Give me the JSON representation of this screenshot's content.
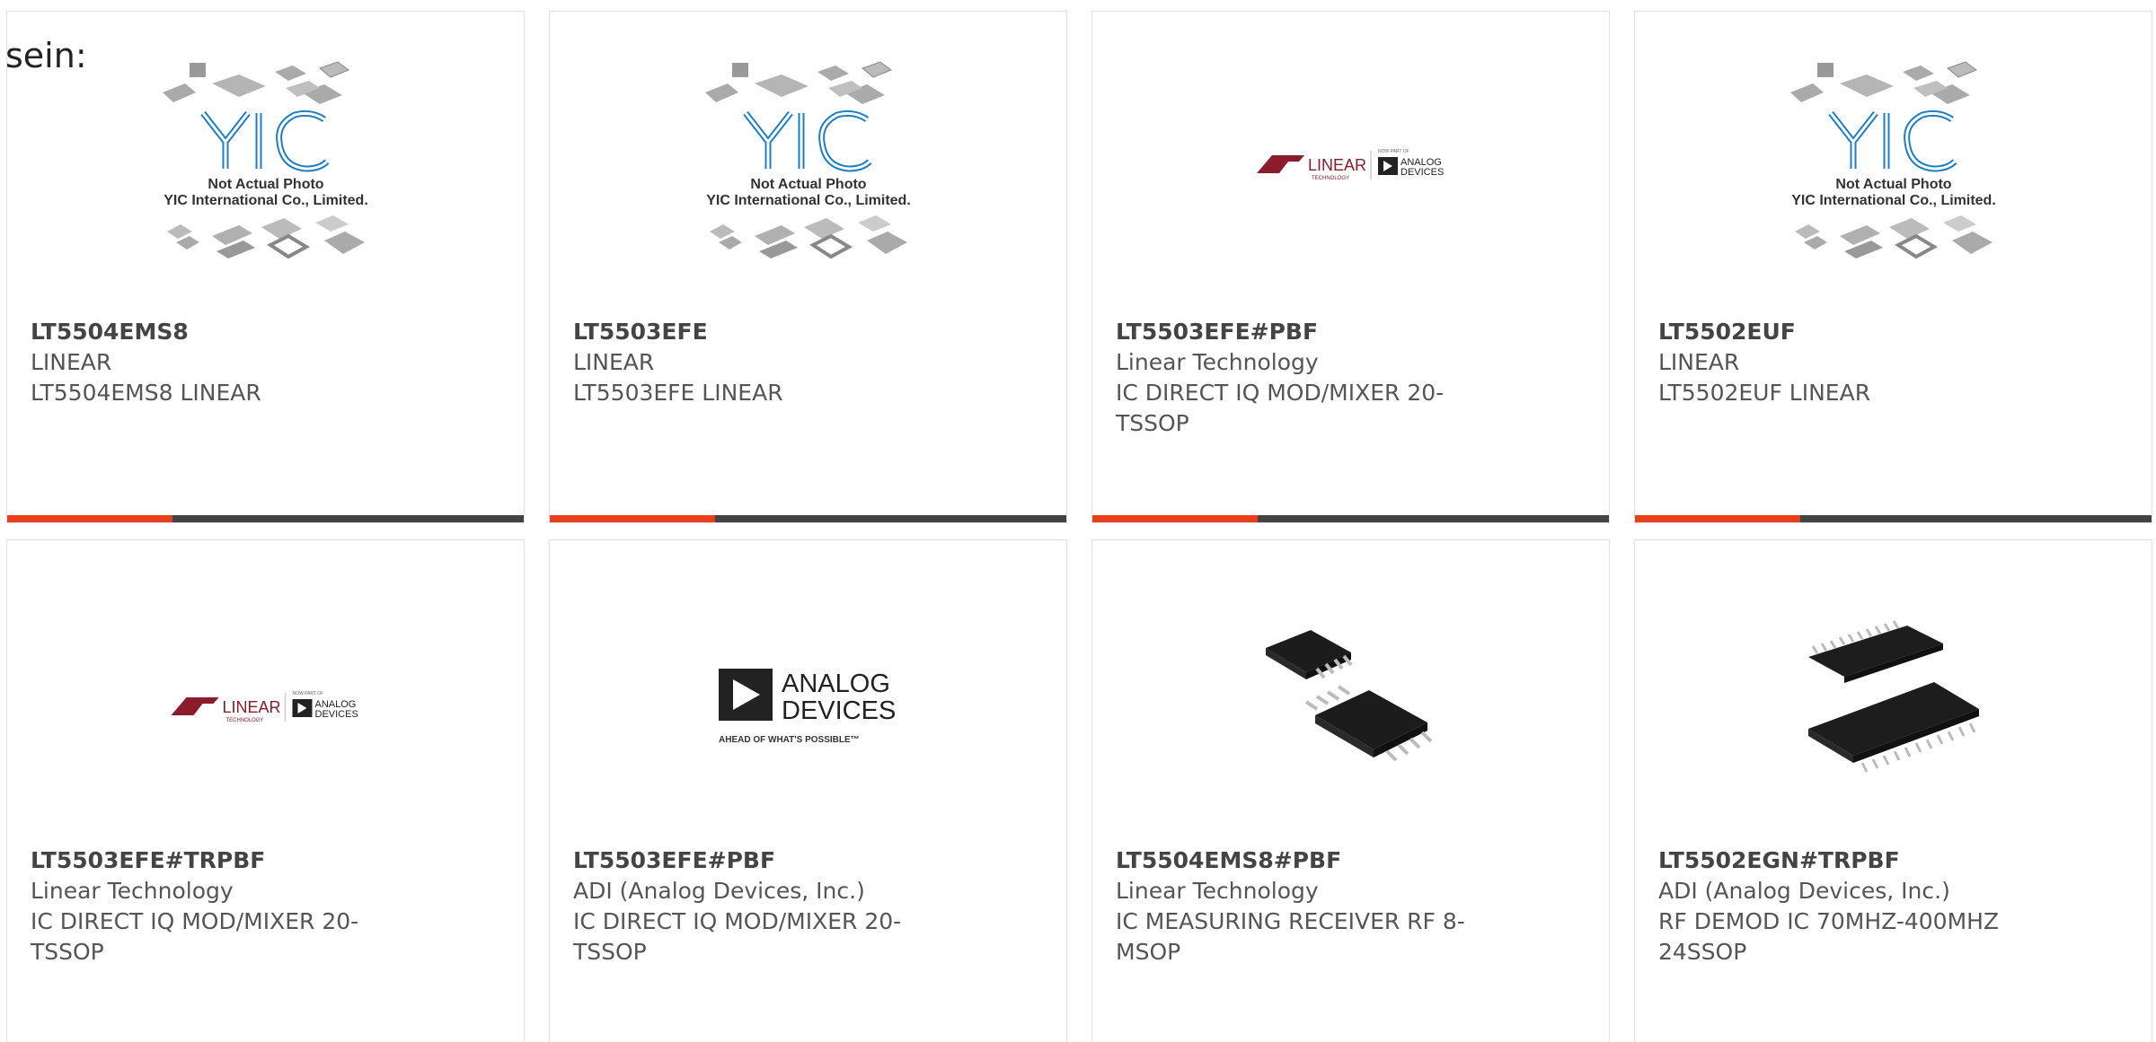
{
  "top_text": "sein:",
  "placeholder": {
    "brand": "YIC",
    "line1": "Not Actual Photo",
    "line2": "YIC International Co., Limited."
  },
  "linear_logo": {
    "brand": "LINEAR",
    "sub": "TECHNOLOGY",
    "now_part_of": "NOW PART OF",
    "adi": [
      "ANALOG",
      "DEVICES"
    ]
  },
  "adi_logo": {
    "line1": "ANALOG",
    "line2": "DEVICES",
    "tagline": "AHEAD OF WHAT'S POSSIBLE™"
  },
  "colors": {
    "accent": "#e8401c",
    "bar": "#434343",
    "yic_blue": "#1f7fc1",
    "linear_red": "#8b1c2c"
  },
  "products": [
    {
      "part": "LT5504EMS8",
      "maker": "LINEAR",
      "desc": "LT5504EMS8 LINEAR",
      "image": "yic-placeholder"
    },
    {
      "part": "LT5503EFE",
      "maker": "LINEAR",
      "desc": "LT5503EFE LINEAR",
      "image": "yic-placeholder"
    },
    {
      "part": "LT5503EFE#PBF",
      "maker": "Linear Technology",
      "desc": "IC DIRECT IQ MOD/MIXER 20-TSSOP",
      "image": "linear-adi-logo"
    },
    {
      "part": "LT5502EUF",
      "maker": "LINEAR",
      "desc": "LT5502EUF LINEAR",
      "image": "yic-placeholder"
    },
    {
      "part": "LT5503EFE#TRPBF",
      "maker": "Linear Technology",
      "desc": "IC DIRECT IQ MOD/MIXER 20-TSSOP",
      "image": "linear-adi-logo"
    },
    {
      "part": "LT5503EFE#PBF",
      "maker": "ADI (Analog Devices, Inc.)",
      "desc": "IC DIRECT IQ MOD/MIXER 20-TSSOP",
      "image": "adi-logo"
    },
    {
      "part": "LT5504EMS8#PBF",
      "maker": "Linear Technology",
      "desc": "IC MEASURING RECEIVER RF 8-MSOP",
      "image": "msop-chip-photo"
    },
    {
      "part": "LT5502EGN#TRPBF",
      "maker": "ADI (Analog Devices, Inc.)",
      "desc": "RF DEMOD IC 70MHZ-400MHZ 24SSOP",
      "image": "ssop-chip-photo"
    }
  ]
}
